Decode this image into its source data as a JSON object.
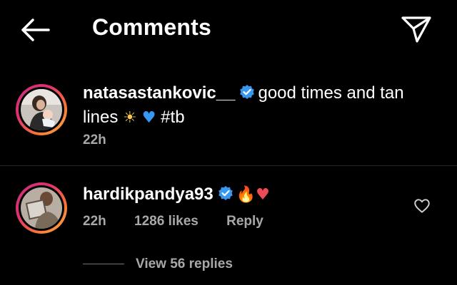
{
  "header": {
    "title": "Comments"
  },
  "caption": {
    "username": "natasastankovic__",
    "text": "good times and tan lines",
    "emojis": "☀ 💙",
    "hashtag": "#tb",
    "time": "22h"
  },
  "comment": {
    "username": "hardikpandya93",
    "emojis": "🔥❤",
    "time": "22h",
    "likes": "1286 likes",
    "reply_label": "Reply",
    "view_replies": "View 56 replies"
  },
  "colors": {
    "background": "#000000",
    "verified": "#3897f0",
    "secondary_text": "#a8a8a8",
    "heart_red": "#ed4956",
    "blue_heart": "#3897f0"
  }
}
